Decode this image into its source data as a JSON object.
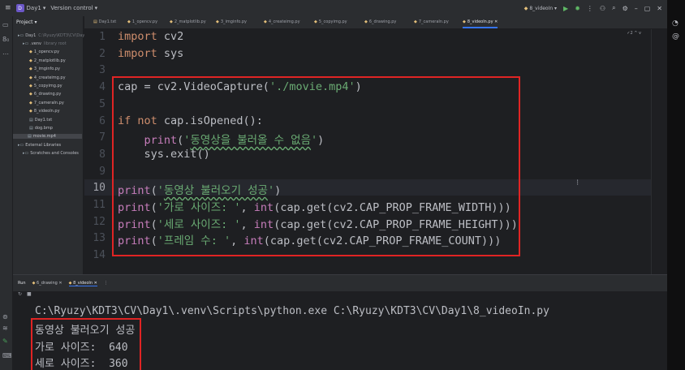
{
  "titlebar": {
    "menu_icon": "hamburger-icon",
    "project_badge": "D",
    "project_name": "Day1",
    "vcs_label": "Version control",
    "run_config": "8_videoIn",
    "window_icons": [
      "user-icon",
      "search-icon",
      "gear-icon",
      "minimize-icon",
      "maximize-icon",
      "close-icon"
    ]
  },
  "project_panel": {
    "title": "Project",
    "tree": [
      {
        "label": "Day1",
        "extra": "C:\\Ryuzy\\KDT3\\CV\\Day1",
        "kind": "dir"
      },
      {
        "label": ".venv",
        "extra": "library root",
        "kind": "dir"
      },
      {
        "label": "1_opencv.py",
        "extra": "",
        "kind": "py"
      },
      {
        "label": "2_matplotlib.py",
        "extra": "",
        "kind": "py"
      },
      {
        "label": "3_imginfo.py",
        "extra": "",
        "kind": "py"
      },
      {
        "label": "4_createimg.py",
        "extra": "",
        "kind": "py"
      },
      {
        "label": "5_copyimg.py",
        "extra": "",
        "kind": "py"
      },
      {
        "label": "6_drawing.py",
        "extra": "",
        "kind": "py"
      },
      {
        "label": "7_cameraIn.py",
        "extra": "",
        "kind": "py"
      },
      {
        "label": "8_videoIn.py",
        "extra": "",
        "kind": "py"
      },
      {
        "label": "Day1.txt",
        "extra": "",
        "kind": "file"
      },
      {
        "label": "dog.bmp",
        "extra": "",
        "kind": "file"
      },
      {
        "label": "movie.mp4",
        "extra": "",
        "kind": "file"
      },
      {
        "label": "External Libraries",
        "extra": "",
        "kind": "dir"
      },
      {
        "label": "Scratches and Consoles",
        "extra": "",
        "kind": "dir"
      }
    ]
  },
  "tabs": [
    "Day1.txt",
    "1_opencv.py",
    "2_matplotlib.py",
    "3_imginfo.py",
    "4_createimg.py",
    "5_copyimg.py",
    "6_drawing.py",
    "7_cameraIn.py",
    "8_videoIn.py"
  ],
  "editor": {
    "inspection_hint": "✓2 ^ v",
    "line_numbers": [
      "1",
      "2",
      "3",
      "4",
      "5",
      "6",
      "7",
      "8",
      "9",
      "10",
      "11",
      "12",
      "13",
      "14"
    ],
    "current_line": "10",
    "lines": [
      "import cv2",
      "import sys",
      "",
      "cap = cv2.VideoCapture('./movie.mp4')",
      "",
      "if not cap.isOpened():",
      "    print('동영상을 불러올 수 없음')",
      "    sys.exit()",
      "",
      "print('동영상 불러오기 성공')",
      "print('가로 사이즈: ', int(cap.get(cv2.CAP_PROP_FRAME_WIDTH)))",
      "print('세로 사이즈: ', int(cap.get(cv2.CAP_PROP_FRAME_HEIGHT)))",
      "print('프레임 수: ', int(cap.get(cv2.CAP_PROP_FRAME_COUNT)))",
      ""
    ]
  },
  "run_panel": {
    "label": "Run",
    "tabs": [
      "6_drawing",
      "8_videoIn"
    ],
    "toolbar_icons": [
      "rerun-icon",
      "stop-icon"
    ],
    "command": "C:\\Ryuzy\\KDT3\\CV\\Day1\\.venv\\Scripts\\python.exe C:\\Ryuzy\\KDT3\\CV\\Day1\\8_videoIn.py",
    "output": [
      "동영상 불러오기 성공",
      "가로 사이즈:  640",
      "세로 사이즈:  360"
    ]
  },
  "colors": {
    "highlight_box": "#e02424",
    "keyword": "#cf8e6d",
    "builtin": "#c77dbb",
    "string": "#6aab73",
    "background": "#1e1f22"
  }
}
